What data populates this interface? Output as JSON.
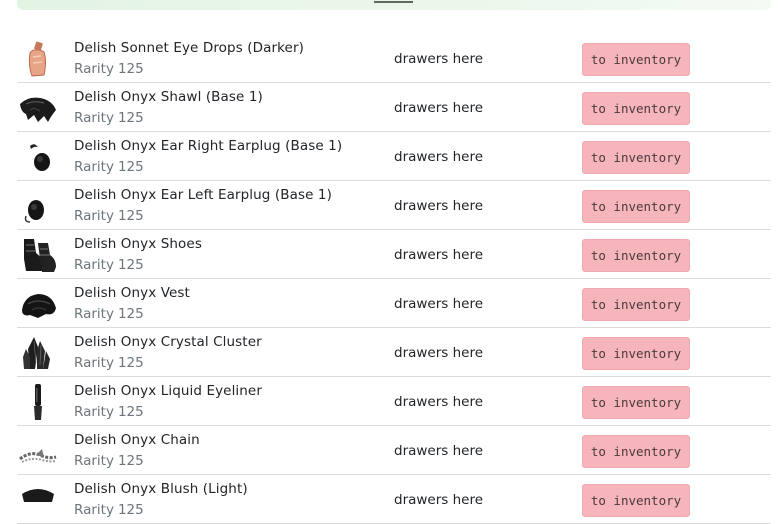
{
  "items": [
    {
      "name": "Delish Sonnet Eye Drops (Darker)",
      "rarity_label": "Rarity",
      "rarity": "125",
      "location": "drawers here",
      "action": "to inventory",
      "icon": "eye-drops-bottle-icon"
    },
    {
      "name": "Delish Onyx Shawl (Base 1)",
      "rarity_label": "Rarity",
      "rarity": "125",
      "location": "drawers here",
      "action": "to inventory",
      "icon": "shawl-icon"
    },
    {
      "name": "Delish Onyx Ear Right Earplug (Base 1)",
      "rarity_label": "Rarity",
      "rarity": "125",
      "location": "drawers here",
      "action": "to inventory",
      "icon": "earplug-right-icon"
    },
    {
      "name": "Delish Onyx Ear Left Earplug (Base 1)",
      "rarity_label": "Rarity",
      "rarity": "125",
      "location": "drawers here",
      "action": "to inventory",
      "icon": "earplug-left-icon"
    },
    {
      "name": "Delish Onyx Shoes",
      "rarity_label": "Rarity",
      "rarity": "125",
      "location": "drawers here",
      "action": "to inventory",
      "icon": "shoes-icon"
    },
    {
      "name": "Delish Onyx Vest",
      "rarity_label": "Rarity",
      "rarity": "125",
      "location": "drawers here",
      "action": "to inventory",
      "icon": "vest-icon"
    },
    {
      "name": "Delish Onyx Crystal Cluster",
      "rarity_label": "Rarity",
      "rarity": "125",
      "location": "drawers here",
      "action": "to inventory",
      "icon": "crystal-cluster-icon"
    },
    {
      "name": "Delish Onyx Liquid Eyeliner",
      "rarity_label": "Rarity",
      "rarity": "125",
      "location": "drawers here",
      "action": "to inventory",
      "icon": "eyeliner-icon"
    },
    {
      "name": "Delish Onyx Chain",
      "rarity_label": "Rarity",
      "rarity": "125",
      "location": "drawers here",
      "action": "to inventory",
      "icon": "chain-icon"
    },
    {
      "name": "Delish Onyx Blush (Light)",
      "rarity_label": "Rarity",
      "rarity": "125",
      "location": "drawers here",
      "action": "to inventory",
      "icon": "blush-icon"
    }
  ],
  "colors": {
    "button_bg": "#f5b5bb",
    "banner": "#e3f4e3",
    "muted_text": "#6c757d"
  }
}
